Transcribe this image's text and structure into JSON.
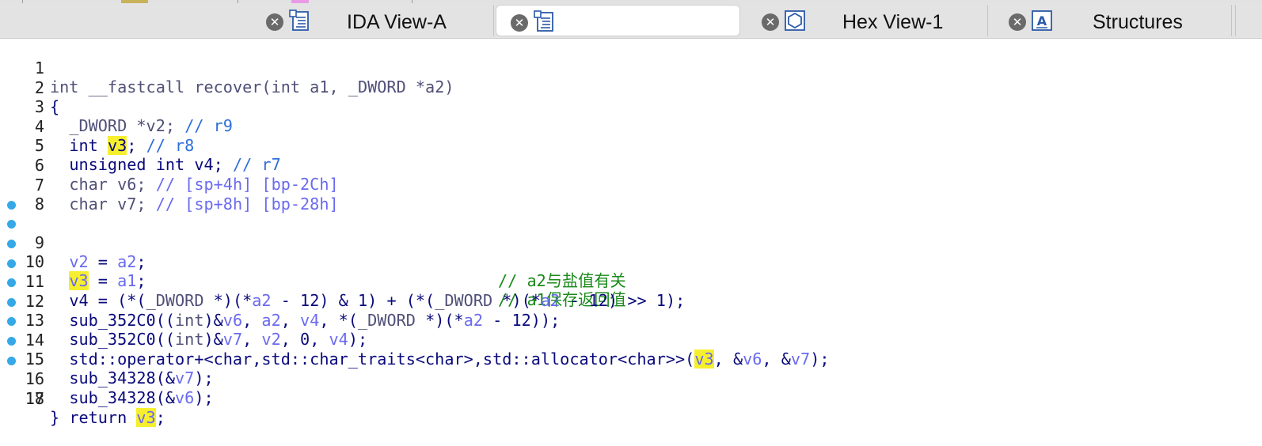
{
  "tabs": [
    {
      "label": "IDA View-A",
      "icon": "disassembly-view-icon",
      "active": false
    },
    {
      "label": "",
      "icon": "pseudocode-view-icon",
      "active": true
    },
    {
      "label": "Hex View-1",
      "icon": "hex-view-icon",
      "active": false
    },
    {
      "label": "Structures",
      "icon": "structures-icon",
      "active": false
    }
  ],
  "code": {
    "line_numbers": [
      "1",
      "2",
      "3",
      "4",
      "5",
      "6",
      "7",
      "8",
      "9",
      "10",
      "11",
      "12",
      "13",
      "14",
      "15",
      "16",
      "17",
      "18"
    ],
    "breakpoint_lines": [
      9,
      10,
      11,
      12,
      13,
      14,
      15,
      16,
      17
    ],
    "l1": {
      "ret": "int",
      "conv": " __fastcall ",
      "fn": "recover(",
      "t1": "int",
      "p1": " a1, ",
      "t2": "_DWORD",
      "p2": " *a2)"
    },
    "l2": "{",
    "l3": {
      "type": "_DWORD",
      "name": " *v2; ",
      "cm": "// r9"
    },
    "l4": {
      "type": "int ",
      "var": "v3",
      "rest": "; ",
      "cm": "// r8"
    },
    "l5": {
      "type": "unsigned int",
      "name": " v4; ",
      "cm": "// r7"
    },
    "l6": {
      "type": "char",
      "name": " v6; ",
      "cm": "// [sp+4h] [bp-2Ch]"
    },
    "l7": {
      "type": "char",
      "name": " v7; ",
      "cm": "// [sp+8h] [bp-28h]"
    },
    "l9": {
      "lhs": "v2",
      "op": " = ",
      "rhs": "a2",
      "end": ";",
      "comment": "// a2与盐值有关"
    },
    "l10": {
      "lhs": "v3",
      "op": " = ",
      "rhs": "a1",
      "end": ";",
      "comment": "// a1保存返回值"
    },
    "l11": {
      "v4": "v4",
      "a": " = (*(",
      "dw1": "_DWORD",
      "b": " *)(*",
      "a2a": "a2",
      "c": " - 12) & 1) + (*(",
      "dw2": "_DWORD",
      "d": " *)(*",
      "a2b": "a2",
      "e": " - 12) >> 1);"
    },
    "l12": {
      "fn": "sub_352C0((",
      "int": "int",
      "a": ")&",
      "v6": "v6",
      "b": ", ",
      "a2": "a2",
      "c": ", ",
      "v4": "v4",
      "d": ", *(",
      "dw": "_DWORD",
      "e": " *)(*",
      "a2b": "a2",
      "f": " - 12));"
    },
    "l13": {
      "fn": "sub_352C0((",
      "int": "int",
      "a": ")&",
      "v7": "v7",
      "b": ", ",
      "v2": "v2",
      "c": ", 0, ",
      "v4": "v4",
      "d": ");"
    },
    "l14": {
      "fn": "std::operator+<char,std::char_traits<char>,std::allocator<char>>(",
      "v3": "v3",
      "a": ", &",
      "v6": "v6",
      "b": ", &",
      "v7": "v7",
      "c": ");"
    },
    "l15": {
      "fn": "sub_34328(&",
      "v": "v7",
      "end": ");"
    },
    "l16": {
      "fn": "sub_34328(&",
      "v": "v6",
      "end": ");"
    },
    "l17": {
      "kw": "return ",
      "v": "v3",
      "end": ";"
    },
    "l18": "}"
  },
  "colors": {
    "highlight": "#f6ef2e",
    "breakpoint": "#35a8e8",
    "comment_green": "#1a8a1a",
    "plain_text": "#0a0a7c",
    "variable": "#6a6af0"
  }
}
